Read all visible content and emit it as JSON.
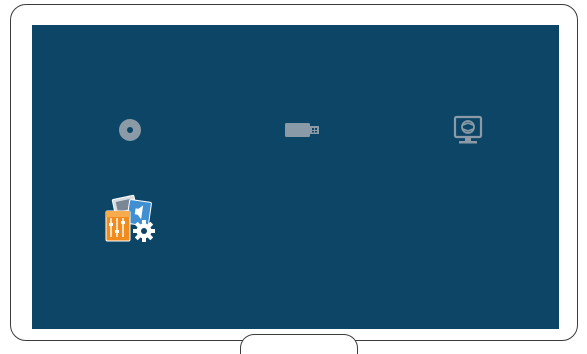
{
  "screen": {
    "background": "#0c4566"
  },
  "menu": {
    "items": [
      {
        "icon": "disc-icon",
        "state": "dimmed"
      },
      {
        "icon": "usb-drive-icon",
        "state": "dimmed"
      },
      {
        "icon": "screen-mirroring-icon",
        "state": "dimmed"
      },
      {
        "icon": "settings-icon",
        "state": "active"
      }
    ]
  }
}
